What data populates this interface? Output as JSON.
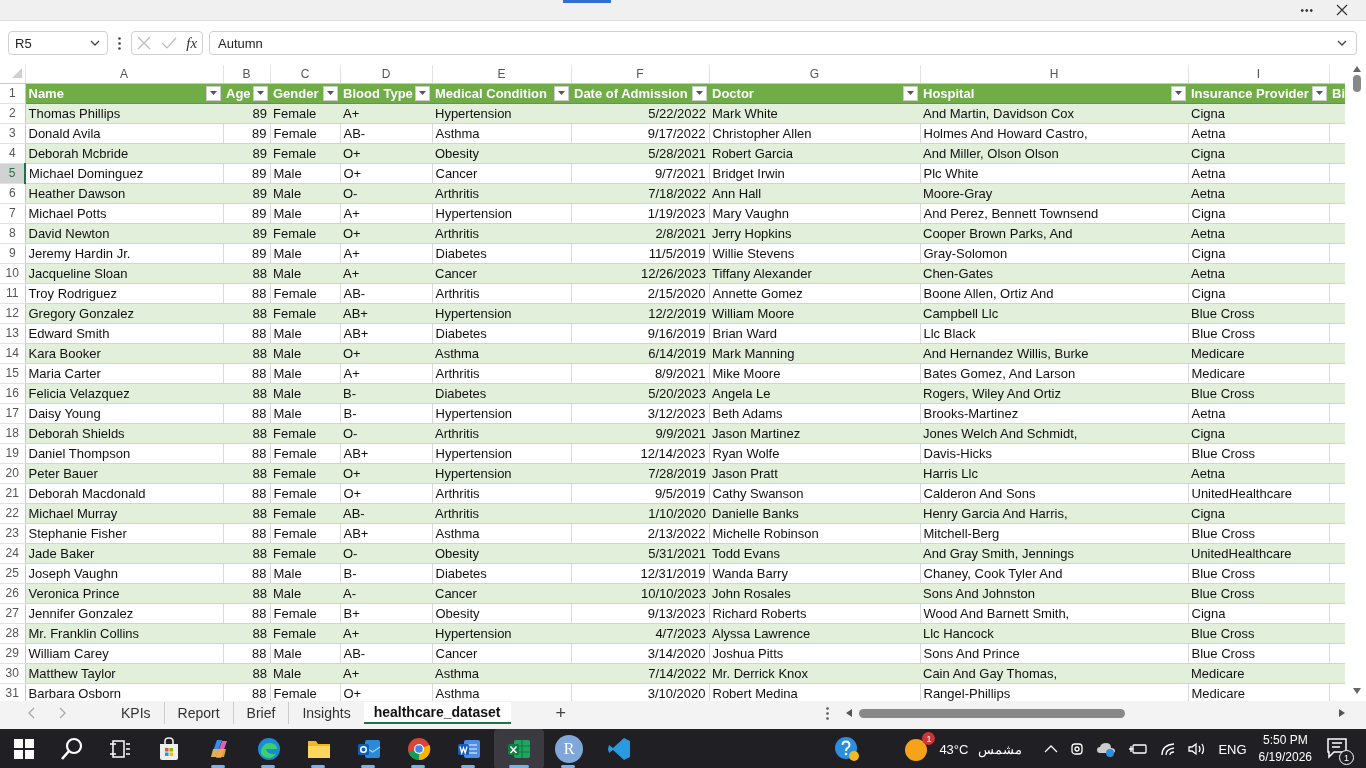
{
  "toolbar": {
    "more": "•••"
  },
  "formula_bar": {
    "name_box": "R5",
    "function_symbol": "fx",
    "value": "Autumn"
  },
  "sheet": {
    "columns": [
      {
        "letter": "A",
        "title": "Name",
        "kind": "text",
        "filter": true
      },
      {
        "letter": "B",
        "title": "Age",
        "kind": "number",
        "filter": true
      },
      {
        "letter": "C",
        "title": "Gender",
        "kind": "text",
        "filter": true
      },
      {
        "letter": "D",
        "title": "Blood Type",
        "kind": "text",
        "filter": true
      },
      {
        "letter": "E",
        "title": "Medical Condition",
        "kind": "text",
        "filter": true
      },
      {
        "letter": "F",
        "title": "Date of Admission",
        "kind": "number",
        "filter": true
      },
      {
        "letter": "G",
        "title": "Doctor",
        "kind": "text",
        "filter": true
      },
      {
        "letter": "H",
        "title": "Hospital",
        "kind": "text",
        "filter": true
      },
      {
        "letter": "I",
        "title": "Insurance Provider",
        "kind": "text",
        "filter": true
      },
      {
        "title": "Bi",
        "filter": false
      }
    ],
    "header_row": "1",
    "rows": [
      {
        "number": "2",
        "selected": false,
        "cells": [
          "Thomas Phillips",
          "89",
          "Female",
          "A+",
          "Hypertension",
          "5/22/2022",
          "Mark White",
          "And Martin, Davidson Cox",
          "Cigna"
        ]
      },
      {
        "number": "3",
        "selected": false,
        "cells": [
          "Donald Avila",
          "89",
          "Female",
          "AB-",
          "Asthma",
          "9/17/2022",
          "Christopher Allen",
          "Holmes And Howard Castro,",
          "Aetna"
        ]
      },
      {
        "number": "4",
        "selected": false,
        "cells": [
          "Deborah Mcbride",
          "89",
          "Female",
          "O+",
          "Obesity",
          "5/28/2021",
          "Robert Garcia",
          "And Miller, Olson Olson",
          "Cigna"
        ]
      },
      {
        "number": "5",
        "selected": true,
        "cells": [
          "Michael Dominguez",
          "89",
          "Male",
          "O+",
          "Cancer",
          "9/7/2021",
          "Bridget Irwin",
          "Plc White",
          "Aetna"
        ]
      },
      {
        "number": "6",
        "selected": false,
        "cells": [
          "Heather Dawson",
          "89",
          "Male",
          "O-",
          "Arthritis",
          "7/18/2022",
          "Ann Hall",
          "Moore-Gray",
          "Aetna"
        ]
      },
      {
        "number": "7",
        "selected": false,
        "cells": [
          "Michael Potts",
          "89",
          "Male",
          "A+",
          "Hypertension",
          "1/19/2023",
          "Mary Vaughn",
          "And Perez, Bennett Townsend",
          "Cigna"
        ]
      },
      {
        "number": "8",
        "selected": false,
        "cells": [
          "David Newton",
          "89",
          "Female",
          "O+",
          "Arthritis",
          "2/8/2021",
          "Jerry Hopkins",
          "Cooper Brown Parks, And",
          "Aetna"
        ]
      },
      {
        "number": "9",
        "selected": false,
        "cells": [
          "Jeremy Hardin Jr.",
          "89",
          "Male",
          "A+",
          "Diabetes",
          "11/5/2019",
          "Willie Stevens",
          "Gray-Solomon",
          "Cigna"
        ]
      },
      {
        "number": "10",
        "selected": false,
        "cells": [
          "Jacqueline Sloan",
          "88",
          "Male",
          "A+",
          "Cancer",
          "12/26/2023",
          "Tiffany Alexander",
          "Chen-Gates",
          "Aetna"
        ]
      },
      {
        "number": "11",
        "selected": false,
        "cells": [
          "Troy Rodriguez",
          "88",
          "Female",
          "AB-",
          "Arthritis",
          "2/15/2020",
          "Annette Gomez",
          "Boone Allen, Ortiz And",
          "Cigna"
        ]
      },
      {
        "number": "12",
        "selected": false,
        "cells": [
          "Gregory Gonzalez",
          "88",
          "Female",
          "AB+",
          "Hypertension",
          "12/2/2019",
          "William Moore",
          "Campbell Llc",
          "Blue Cross"
        ]
      },
      {
        "number": "13",
        "selected": false,
        "cells": [
          "Edward Smith",
          "88",
          "Male",
          "AB+",
          "Diabetes",
          "9/16/2019",
          "Brian Ward",
          "Llc Black",
          "Blue Cross"
        ]
      },
      {
        "number": "14",
        "selected": false,
        "cells": [
          "Kara Booker",
          "88",
          "Male",
          "O+",
          "Asthma",
          "6/14/2019",
          "Mark Manning",
          "And Hernandez Willis, Burke",
          "Medicare"
        ]
      },
      {
        "number": "15",
        "selected": false,
        "cells": [
          "Maria Carter",
          "88",
          "Male",
          "A+",
          "Arthritis",
          "8/9/2021",
          "Mike Moore",
          "Bates Gomez, And Larson",
          "Medicare"
        ]
      },
      {
        "number": "16",
        "selected": false,
        "cells": [
          "Felicia Velazquez",
          "88",
          "Male",
          "B-",
          "Diabetes",
          "5/20/2023",
          "Angela Le",
          "Rogers, Wiley And Ortiz",
          "Blue Cross"
        ]
      },
      {
        "number": "17",
        "selected": false,
        "cells": [
          "Daisy Young",
          "88",
          "Male",
          "B-",
          "Hypertension",
          "3/12/2023",
          "Beth Adams",
          "Brooks-Martinez",
          "Aetna"
        ]
      },
      {
        "number": "18",
        "selected": false,
        "cells": [
          "Deborah Shields",
          "88",
          "Female",
          "O-",
          "Arthritis",
          "9/9/2021",
          "Jason Martinez",
          "Jones Welch And Schmidt,",
          "Cigna"
        ]
      },
      {
        "number": "19",
        "selected": false,
        "cells": [
          "Daniel Thompson",
          "88",
          "Female",
          "AB+",
          "Hypertension",
          "12/14/2023",
          "Ryan Wolfe",
          "Davis-Hicks",
          "Blue Cross"
        ]
      },
      {
        "number": "20",
        "selected": false,
        "cells": [
          "Peter Bauer",
          "88",
          "Female",
          "O+",
          "Hypertension",
          "7/28/2019",
          "Jason Pratt",
          "Harris Llc",
          "Aetna"
        ]
      },
      {
        "number": "21",
        "selected": false,
        "cells": [
          "Deborah Macdonald",
          "88",
          "Female",
          "O+",
          "Arthritis",
          "9/5/2019",
          "Cathy Swanson",
          "Calderon And Sons",
          "UnitedHealthcare"
        ]
      },
      {
        "number": "22",
        "selected": false,
        "cells": [
          "Michael Murray",
          "88",
          "Female",
          "AB-",
          "Arthritis",
          "1/10/2020",
          "Danielle Banks",
          "Henry Garcia And Harris,",
          "Cigna"
        ]
      },
      {
        "number": "23",
        "selected": false,
        "cells": [
          "Stephanie Fisher",
          "88",
          "Female",
          "AB+",
          "Asthma",
          "2/13/2022",
          "Michelle Robinson",
          "Mitchell-Berg",
          "Blue Cross"
        ]
      },
      {
        "number": "24",
        "selected": false,
        "cells": [
          "Jade Baker",
          "88",
          "Female",
          "O-",
          "Obesity",
          "5/31/2021",
          "Todd Evans",
          "And Gray Smith, Jennings",
          "UnitedHealthcare"
        ]
      },
      {
        "number": "25",
        "selected": false,
        "cells": [
          "Joseph Vaughn",
          "88",
          "Male",
          "B-",
          "Diabetes",
          "12/31/2019",
          "Wanda Barry",
          "Chaney, Cook Tyler And",
          "Blue Cross"
        ]
      },
      {
        "number": "26",
        "selected": false,
        "cells": [
          "Veronica Prince",
          "88",
          "Male",
          "A-",
          "Cancer",
          "10/10/2023",
          "John Rosales",
          "Sons And Johnston",
          "Blue Cross"
        ]
      },
      {
        "number": "27",
        "selected": false,
        "cells": [
          "Jennifer Gonzalez",
          "88",
          "Female",
          "B+",
          "Obesity",
          "9/13/2023",
          "Richard Roberts",
          "Wood And Barnett Smith,",
          "Cigna"
        ]
      },
      {
        "number": "28",
        "selected": false,
        "cells": [
          "Mr. Franklin Collins",
          "88",
          "Female",
          "A+",
          "Hypertension",
          "4/7/2023",
          "Alyssa Lawrence",
          "Llc Hancock",
          "Blue Cross"
        ]
      },
      {
        "number": "29",
        "selected": false,
        "cells": [
          "William Carey",
          "88",
          "Male",
          "AB-",
          "Cancer",
          "3/14/2020",
          "Joshua Pitts",
          "Sons And Prince",
          "Blue Cross"
        ]
      },
      {
        "number": "30",
        "selected": false,
        "cells": [
          "Matthew Taylor",
          "88",
          "Male",
          "A+",
          "Asthma",
          "7/14/2022",
          "Mr. Derrick Knox",
          "Cain And Gay Thomas,",
          "Medicare"
        ]
      },
      {
        "number": "31",
        "selected": false,
        "cells": [
          "Barbara Osborn",
          "88",
          "Female",
          "O+",
          "Asthma",
          "3/10/2020",
          "Robert Medina",
          "Rangel-Phillips",
          "Medicare"
        ]
      }
    ]
  },
  "sheet_tabs": [
    {
      "label": "KPIs",
      "selected": false
    },
    {
      "label": "Report",
      "selected": false
    },
    {
      "label": "Brief",
      "selected": false
    },
    {
      "label": "Insights",
      "selected": false
    },
    {
      "label": "healthcare_dataset",
      "selected": true
    }
  ],
  "add_sheet": "+",
  "taskbar": {
    "apps": [
      {
        "kind": "start",
        "running": false,
        "active": false
      },
      {
        "kind": "search",
        "running": false,
        "active": false
      },
      {
        "kind": "taskview",
        "running": false,
        "active": false
      },
      {
        "kind": "store",
        "running": false,
        "active": false
      },
      {
        "kind": "copilot",
        "running": true,
        "active": false
      },
      {
        "kind": "edge",
        "running": true,
        "active": false
      },
      {
        "kind": "folder",
        "running": true,
        "active": false
      },
      {
        "kind": "outlook",
        "running": true,
        "active": false
      },
      {
        "kind": "chrome",
        "running": true,
        "active": false
      },
      {
        "kind": "word",
        "running": true,
        "active": false
      },
      {
        "kind": "excel",
        "running": true,
        "active": true
      },
      {
        "kind": "r",
        "label": "R",
        "running": true,
        "active": false
      },
      {
        "kind": "vscode",
        "running": false,
        "active": false
      }
    ],
    "weather": {
      "badge": "1",
      "temperature": "43°C",
      "condition": "مشمس"
    },
    "language": "ENG",
    "time": "5:50 PM",
    "date": "6/19/2026",
    "notifications": "1"
  }
}
